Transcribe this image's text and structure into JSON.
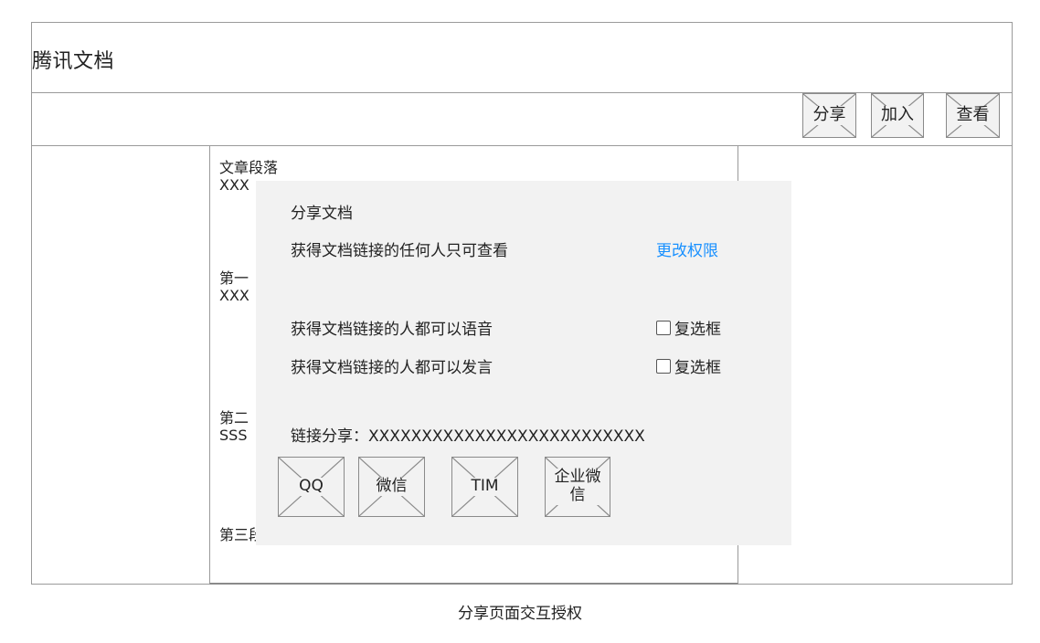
{
  "app": {
    "title": "腾讯文档"
  },
  "toolbar": {
    "buttons": [
      "分享",
      "加入",
      "查看"
    ]
  },
  "article": {
    "heading": "文章段落",
    "p1_line": "XXX",
    "sec1_title": "第一",
    "sec1_line": "XXX",
    "sec2_title": "第二",
    "sec2_line": "SSS",
    "sec3_title": "第三段"
  },
  "share_dialog": {
    "title": "分享文档",
    "permission_text": "获得文档链接的任何人只可查看",
    "change_permission": "更改权限",
    "option_voice": "获得文档链接的人都可以语音",
    "option_speak": "获得文档链接的人都可以发言",
    "checkbox_label": "复选框",
    "link_text": "链接分享：XXXXXXXXXXXXXXXXXXXXXXXXXX",
    "share_targets": [
      "QQ",
      "微信",
      "TIM",
      "企业微信"
    ]
  },
  "caption": "分享页面交互授权",
  "colors": {
    "border": "#9a9a9a",
    "dialog_bg": "#f2f2f2",
    "link": "#1890ff"
  }
}
